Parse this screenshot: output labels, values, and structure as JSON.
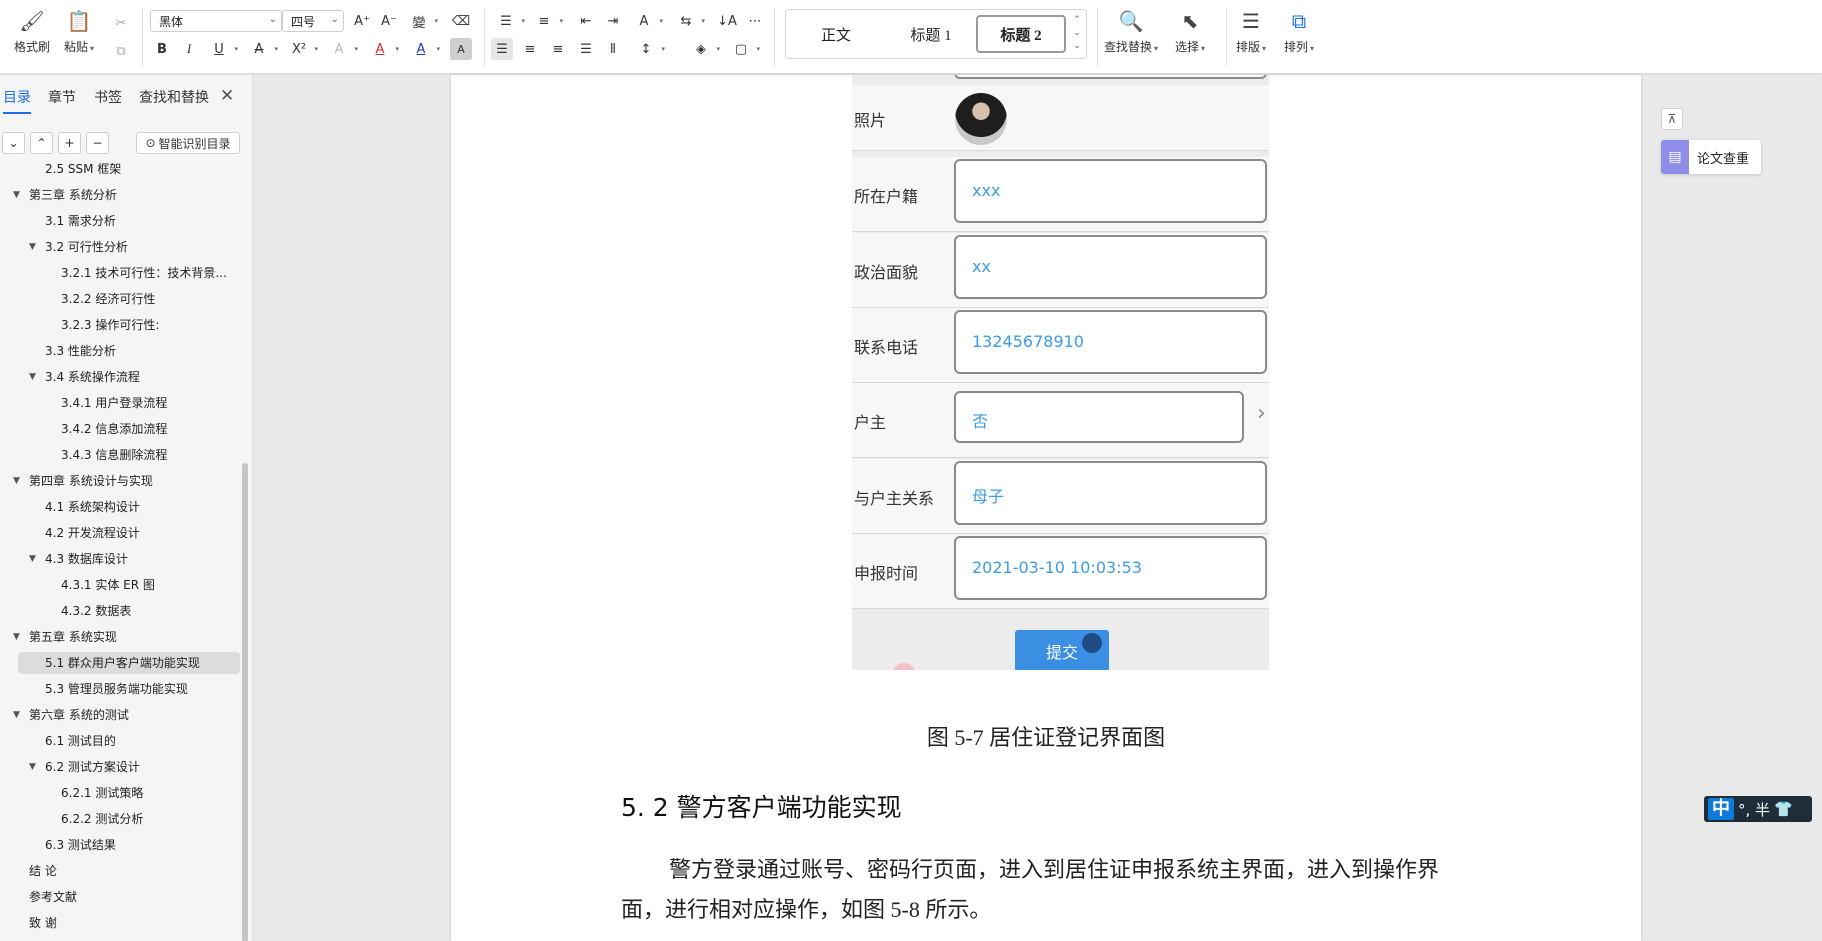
{
  "ribbon": {
    "format_painter": "格式刷",
    "paste": "粘贴",
    "font_name": "黑体",
    "font_size": "四号",
    "styles": {
      "normal": "正文",
      "h1": "标题 1",
      "h2": "标题 2"
    },
    "find_replace": "查找替换",
    "select": "选择",
    "layout": "排版",
    "arrange": "排列"
  },
  "nav": {
    "tabs": [
      "目录",
      "章节",
      "书签",
      "查找和替换"
    ],
    "smart_toc": "智能识别目录",
    "toc": [
      {
        "text": "2.5 SSM 框架",
        "level": 2,
        "tri": false
      },
      {
        "text": "第三章  系统分析",
        "level": 1,
        "tri": true
      },
      {
        "text": "3.1 需求分析",
        "level": 2,
        "tri": false
      },
      {
        "text": "3.2 可行性分析",
        "level": 2,
        "tri": true
      },
      {
        "text": "3.2.1 技术可行性：技术背景...",
        "level": 3,
        "tri": false
      },
      {
        "text": "3.2.2 经济可行性",
        "level": 3,
        "tri": false
      },
      {
        "text": "3.2.3 操作可行性:",
        "level": 3,
        "tri": false
      },
      {
        "text": "3.3 性能分析",
        "level": 2,
        "tri": false
      },
      {
        "text": "3.4 系统操作流程",
        "level": 2,
        "tri": true
      },
      {
        "text": "3.4.1 用户登录流程",
        "level": 3,
        "tri": false
      },
      {
        "text": "3.4.2 信息添加流程",
        "level": 3,
        "tri": false
      },
      {
        "text": "3.4.3 信息删除流程",
        "level": 3,
        "tri": false
      },
      {
        "text": "第四章  系统设计与实现",
        "level": 1,
        "tri": true
      },
      {
        "text": "4.1 系统架构设计",
        "level": 2,
        "tri": false
      },
      {
        "text": "4.2 开发流程设计",
        "level": 2,
        "tri": false
      },
      {
        "text": "4.3 数据库设计",
        "level": 2,
        "tri": true
      },
      {
        "text": "4.3.1 实体 ER 图",
        "level": 3,
        "tri": false
      },
      {
        "text": "4.3.2 数据表",
        "level": 3,
        "tri": false
      },
      {
        "text": "第五章  系统实现",
        "level": 1,
        "tri": true
      },
      {
        "text": "5.1 群众用户客户端功能实现",
        "level": 2,
        "tri": false,
        "active": true
      },
      {
        "text": "5.3 管理员服务端功能实现",
        "level": 2,
        "tri": false
      },
      {
        "text": "第六章   系统的测试",
        "level": 1,
        "tri": true
      },
      {
        "text": "6.1  测试目的",
        "level": 2,
        "tri": false
      },
      {
        "text": "6.2  测试方案设计",
        "level": 2,
        "tri": true
      },
      {
        "text": "6.2.1  测试策略",
        "level": 3,
        "tri": false
      },
      {
        "text": "6.2.2  测试分析",
        "level": 3,
        "tri": false
      },
      {
        "text": "6.3  测试结果",
        "level": 2,
        "tri": false
      },
      {
        "text": "结   论",
        "level": 1,
        "tri": false
      },
      {
        "text": "参考文献",
        "level": 1,
        "tri": false
      },
      {
        "text": "致   谢",
        "level": 1,
        "tri": false
      }
    ]
  },
  "doc": {
    "form": {
      "photo_label": "照片",
      "rows": [
        {
          "label": "所在户籍",
          "value": "xxx"
        },
        {
          "label": "政治面貌",
          "value": "xx"
        },
        {
          "label": "联系电话",
          "value": "13245678910"
        },
        {
          "label": "户主",
          "value": "否"
        },
        {
          "label": "与户主关系",
          "value": "母子"
        },
        {
          "label": "申报时间",
          "value": "2021-03-10 10:03:53"
        }
      ],
      "submit": "提交"
    },
    "caption": "图 5-7 居住证登记界面图",
    "heading": "5. 2 警方客户端功能实现",
    "para_line1": "警方登录通过账号、密码行页面，进入到居住证申报系统主界面，进入到操作界",
    "para_line2": "面，进行相对应操作，如图 5-8 所示。"
  },
  "side": {
    "paper_check": "论文查重",
    "ime_text": "°, 半",
    "ime_zh": "中"
  }
}
